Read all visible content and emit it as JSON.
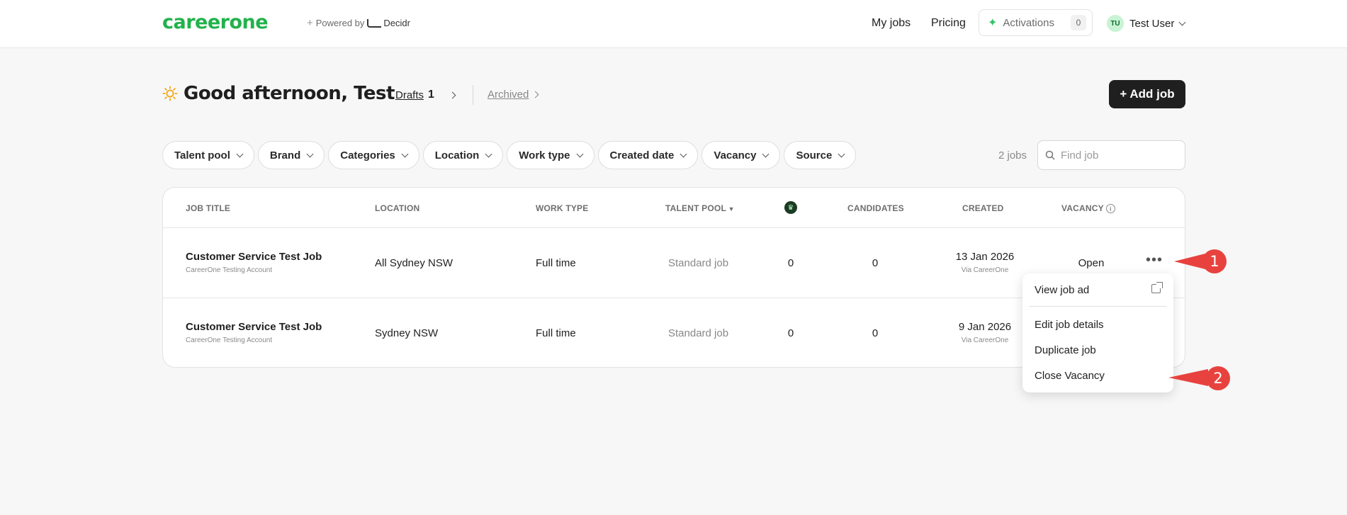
{
  "header": {
    "logo": "careerone",
    "powered_by": "Powered by",
    "partner": "Decidr",
    "nav": {
      "my_jobs": "My jobs",
      "pricing": "Pricing"
    },
    "activations": {
      "label": "Activations",
      "count": "0"
    },
    "user": {
      "initials": "TU",
      "name": "Test User"
    }
  },
  "greeting": {
    "text": "Good afternoon, Test",
    "drafts_label": "Drafts",
    "drafts_count": "1",
    "archived_label": "Archived",
    "add_job": "+ Add job"
  },
  "filters": [
    "Talent pool",
    "Brand",
    "Categories",
    "Location",
    "Work type",
    "Created date",
    "Vacancy",
    "Source"
  ],
  "jobs_count": "2 jobs",
  "search": {
    "placeholder": "Find job"
  },
  "table": {
    "headers": {
      "job_title": "JOB TITLE",
      "location": "LOCATION",
      "work_type": "WORK TYPE",
      "talent_pool": "TALENT POOL",
      "candidates": "CANDIDATES",
      "created": "CREATED",
      "vacancy": "VACANCY"
    },
    "rows": [
      {
        "title": "Customer Service Test Job",
        "account": "CareerOne Testing Account",
        "location": "All Sydney NSW",
        "work_type": "Full time",
        "talent_pool": "Standard job",
        "premium": "0",
        "candidates": "0",
        "created": "13 Jan 2026",
        "via": "Via CareerOne",
        "vacancy": "Open"
      },
      {
        "title": "Customer Service Test Job",
        "account": "CareerOne Testing Account",
        "location": "Sydney NSW",
        "work_type": "Full time",
        "talent_pool": "Standard job",
        "premium": "0",
        "candidates": "0",
        "created": "9 Jan 2026",
        "via": "Via CareerOne",
        "vacancy": ""
      }
    ]
  },
  "menu": {
    "view_job_ad": "View job ad",
    "edit_job_details": "Edit job details",
    "duplicate_job": "Duplicate job",
    "close_vacancy": "Close Vacancy"
  },
  "annotations": [
    "1",
    "2"
  ],
  "colors": {
    "brand": "#22b24c",
    "annotation": "#e8423e",
    "primary_button": "#1f1f1f"
  }
}
